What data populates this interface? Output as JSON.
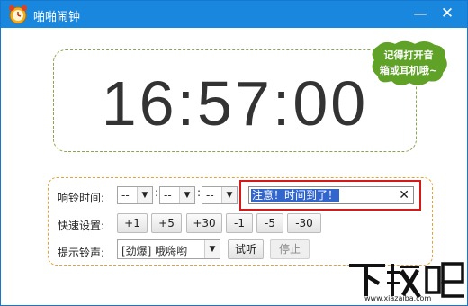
{
  "window": {
    "title": "啪啪闹钟",
    "minimize_label": "—",
    "close_label": "✕"
  },
  "clock": {
    "time": "16:57:00"
  },
  "bubble": {
    "line1": "记得打开音",
    "line2": "箱或耳机哦~"
  },
  "alarm": {
    "label": "响铃时间:",
    "hour": "--",
    "minute": "--",
    "second": "--",
    "separator": ":",
    "message": "注意！时间到了！",
    "clear_label": "✕"
  },
  "quick": {
    "label": "快速设置:",
    "buttons": [
      "+1",
      "+5",
      "+30",
      "-1",
      "-5",
      "-30"
    ]
  },
  "sound": {
    "label": "提示铃声:",
    "selected": "[劲爆] 哦嗨哟",
    "test_label": "试听",
    "stop_label": "停止"
  },
  "watermark": {
    "text": "下载吧",
    "url": "www.xiazaiba.com"
  },
  "colors": {
    "titlebar": "#1a87df",
    "bubble": "#5fa227",
    "highlight": "#3366cc",
    "alert_border": "#d51a1a"
  }
}
